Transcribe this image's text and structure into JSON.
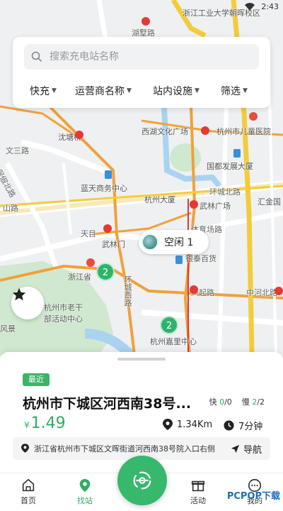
{
  "status": {
    "time": "2:43"
  },
  "map": {
    "labels": {
      "zjut": "浙江工业大学朝晖校区",
      "hutai_road": "湖墅路",
      "shangtang": "沈塘桥",
      "wensan_road": "文三路",
      "xixi_culture": "西湖文化广场",
      "hz_children_hosp": "杭州市儿童医院",
      "baochu_north_road": "保俶北路",
      "lantian_center": "蓝天商务中心",
      "guomao": "国都发展大厦",
      "hz_tower": "杭州大厦",
      "huancheng_north_road": "环城北路",
      "wulin_plaza": "武林广场",
      "huijin": "汇金国",
      "tiyuchang_road": "体育场路",
      "fengqi_road": "凤起路",
      "wulinmen": "武林门",
      "zhejiang_provincial": "浙江省",
      "huancheng_west_road": "环城西路",
      "zhonghe_north_road": "中河北路",
      "laogan_center_1": "杭州市老干",
      "laogan_center_2": "部活动中心",
      "yintai": "银泰百货",
      "fengjing": "风景",
      "jiali_center": "杭州嘉里中心",
      "shanlu": "山路",
      "tianmu": "天目"
    },
    "clusters": [
      "2",
      "2"
    ],
    "tooltip": "空闲 1"
  },
  "search": {
    "placeholder": "搜索充电站名称",
    "filters": [
      "快充",
      "运营商名称",
      "站内设施",
      "筛选"
    ]
  },
  "station": {
    "badge": "最近",
    "name": "杭州市下城区河西南38号...",
    "fast_label": "快",
    "fast_avail": "0",
    "fast_total": "/0",
    "slow_label": "慢",
    "slow_avail": "2",
    "slow_total": "/2",
    "currency": "¥",
    "price": "1.49",
    "distance": "1.34Km",
    "duration": "7分钟",
    "address": "浙江省杭州市下城区文晖街道河西南38号院入口右侧",
    "nav_label": "导航"
  },
  "tabs": [
    "首页",
    "找站",
    "活动",
    "我的"
  ],
  "watermark": "PCPOP下载",
  "colors": {
    "accent": "#2fae62",
    "metro": "#e53935",
    "road_orange": "#f0a13a",
    "road_yellow": "#f3cc3c"
  }
}
